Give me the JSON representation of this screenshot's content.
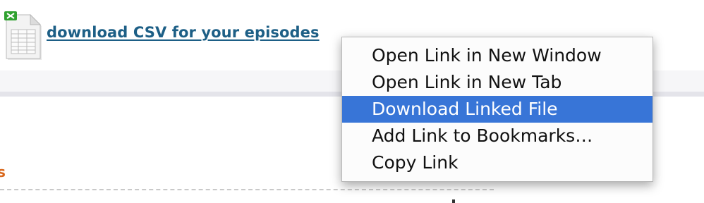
{
  "link": {
    "text": "download CSV for your episodes"
  },
  "orange_fragment": "s",
  "icon": {
    "name": "spreadsheet-file-icon",
    "badge_color": "#2fa12f"
  },
  "context_menu": {
    "items": [
      {
        "label": "Open Link in New Window",
        "highlighted": false
      },
      {
        "label": "Open Link in New Tab",
        "highlighted": false
      },
      {
        "label": "Download Linked File",
        "highlighted": true
      },
      {
        "label": "Add Link to Bookmarks…",
        "highlighted": false
      },
      {
        "label": "Copy Link",
        "highlighted": false
      }
    ],
    "highlight_color": "#3875d7"
  },
  "colors": {
    "link": "#1d5f86",
    "accent_orange": "#d9671b"
  }
}
